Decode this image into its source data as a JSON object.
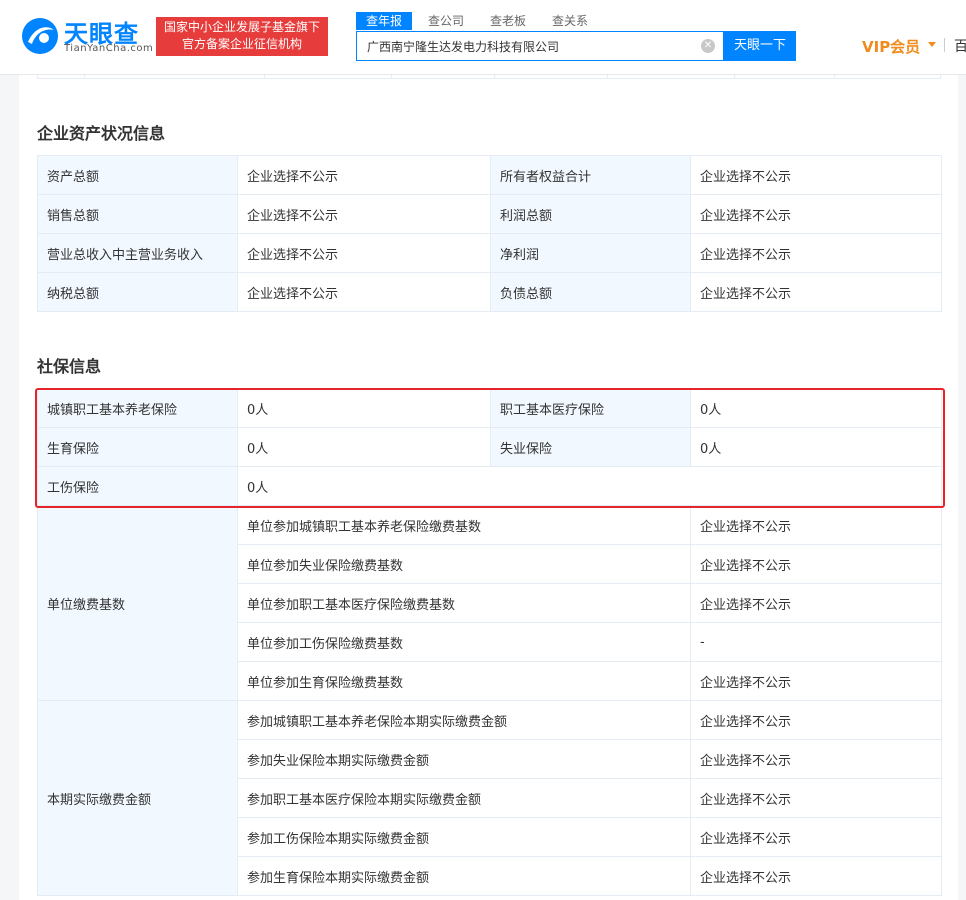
{
  "header": {
    "brand_title": "天眼查",
    "brand_sub": "TianYanCha.com",
    "promo_line1": "国家中小企业发展子基金旗下",
    "promo_line2": "官方备案企业征信机构",
    "tabs": [
      "查年报",
      "查公司",
      "查老板",
      "查关系"
    ],
    "search_value": "广西南宁隆生达发电力科技有限公司",
    "search_button": "天眼一下",
    "vip_label": "VIP会员",
    "cut_text": "百"
  },
  "assets": {
    "title": "企业资产状况信息",
    "rows": [
      {
        "l1": "资产总额",
        "v1": "企业选择不公示",
        "l2": "所有者权益合计",
        "v2": "企业选择不公示"
      },
      {
        "l1": "销售总额",
        "v1": "企业选择不公示",
        "l2": "利润总额",
        "v2": "企业选择不公示"
      },
      {
        "l1": "营业总收入中主营业务收入",
        "v1": "企业选择不公示",
        "l2": "净利润",
        "v2": "企业选择不公示"
      },
      {
        "l1": "纳税总额",
        "v1": "企业选择不公示",
        "l2": "负债总额",
        "v2": "企业选择不公示"
      }
    ]
  },
  "social": {
    "title": "社保信息",
    "rows": [
      {
        "l1": "城镇职工基本养老保险",
        "v1": "0人",
        "l2": "职工基本医疗保险",
        "v2": "0人"
      },
      {
        "l1": "生育保险",
        "v1": "0人",
        "l2": "失业保险",
        "v2": "0人"
      }
    ],
    "injury": {
      "label": "工伤保险",
      "value": "0人"
    },
    "base": {
      "label": "单位缴费基数",
      "items": [
        {
          "name": "单位参加城镇职工基本养老保险缴费基数",
          "value": "企业选择不公示"
        },
        {
          "name": "单位参加失业保险缴费基数",
          "value": "企业选择不公示"
        },
        {
          "name": "单位参加职工基本医疗保险缴费基数",
          "value": "企业选择不公示"
        },
        {
          "name": "单位参加工伤保险缴费基数",
          "value": "-"
        },
        {
          "name": "单位参加生育保险缴费基数",
          "value": "企业选择不公示"
        }
      ]
    },
    "paid": {
      "label": "本期实际缴费金额",
      "items": [
        {
          "name": "参加城镇职工基本养老保险本期实际缴费金额",
          "value": "企业选择不公示"
        },
        {
          "name": "参加失业保险本期实际缴费金额",
          "value": "企业选择不公示"
        },
        {
          "name": "参加职工基本医疗保险本期实际缴费金额",
          "value": "企业选择不公示"
        },
        {
          "name": "参加工伤保险本期实际缴费金额",
          "value": "企业选择不公示"
        },
        {
          "name": "参加生育保险本期实际缴费金额",
          "value": "企业选择不公示"
        }
      ]
    }
  },
  "colors": {
    "brand_blue": "#0084ff",
    "promo_red": "#e63c3c",
    "highlight_red": "#e5242b",
    "label_bg": "#f2f8ff",
    "vip_orange": "#f08c1e"
  }
}
